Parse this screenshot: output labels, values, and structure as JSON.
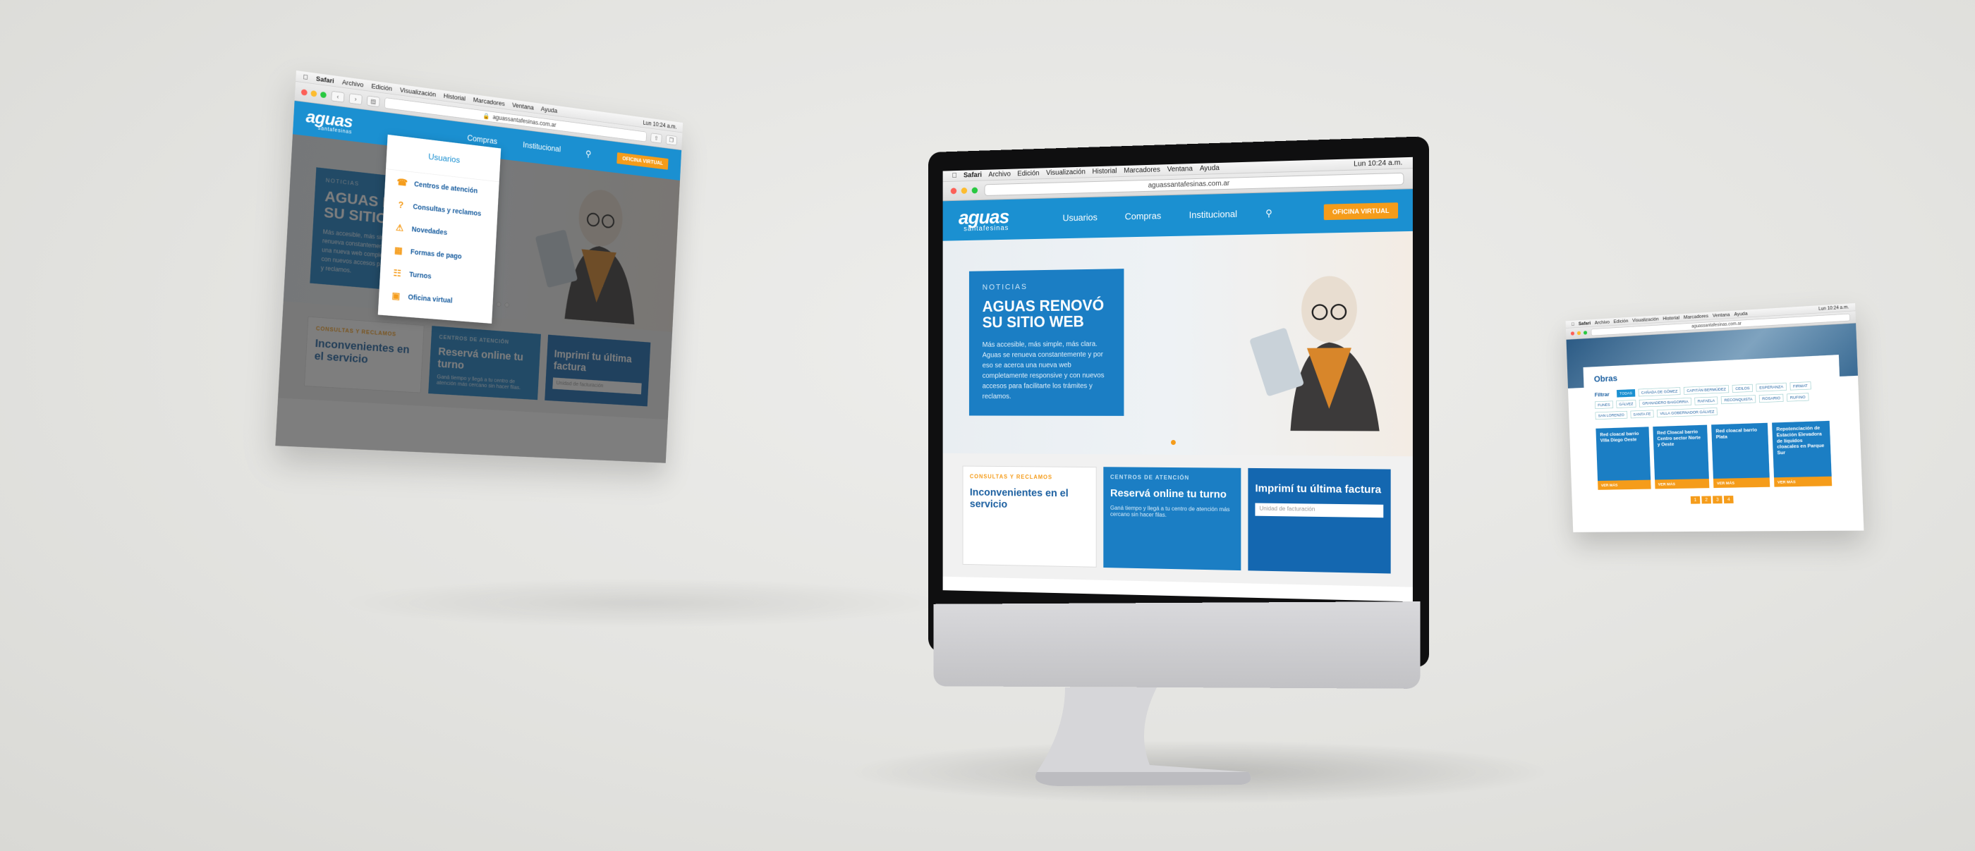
{
  "mac_menu": {
    "apple": "",
    "app": "Safari",
    "items": [
      "Archivo",
      "Edición",
      "Visualización",
      "Historial",
      "Marcadores",
      "Ventana",
      "Ayuda"
    ],
    "clock": "Lun 10:24 a.m."
  },
  "browser": {
    "url": "aguassantafesinas.com.ar"
  },
  "site": {
    "logo": "aguas",
    "logo_sub": "santafesinas",
    "nav": [
      "Usuarios",
      "Compras",
      "Institucional"
    ],
    "oficina_virtual": "OFICINA VIRTUAL",
    "hero_tag": "NOTICIAS",
    "hero_title": "AGUAS RENOVÓ SU SITIO WEB",
    "hero_text": "Más accesible, más simple, más clara. Aguas se renueva constantemente y por eso se acerca una nueva web completamente responsive y con nuevos accesos para facilitarte los trámites y reclamos.",
    "cards": [
      {
        "tag": "CONSULTAS Y RECLAMOS",
        "title": "Inconvenientes en el servicio"
      },
      {
        "tag": "CENTROS DE ATENCIÓN",
        "title": "Reservá online tu turno",
        "text": "Ganá tiempo y llegá a tu centro de atención más cercano sin hacer filas."
      },
      {
        "tag": "",
        "title": "Imprimí tu última factura",
        "placeholder": "Unidad de facturación"
      }
    ]
  },
  "dropdown": {
    "head": "Usuarios",
    "items": [
      {
        "label": "Centros de atención",
        "icon": "headset-icon"
      },
      {
        "label": "Consultas y reclamos",
        "icon": "question-icon"
      },
      {
        "label": "Novedades",
        "icon": "warning-icon"
      },
      {
        "label": "Formas de pago",
        "icon": "card-icon"
      },
      {
        "label": "Turnos",
        "icon": "calendar-icon"
      },
      {
        "label": "Oficina virtual",
        "icon": "window-icon"
      }
    ]
  },
  "obras": {
    "title": "Obras",
    "filter_label": "Filtrar",
    "chips": [
      "TODAS",
      "CAÑADA DE GÓMEZ",
      "CAPITÁN BERMÚDEZ",
      "CEILOS",
      "ESPERANZA",
      "FIRMAT",
      "FUNES",
      "GÁLVEZ",
      "GRANADERO BAIGORRIA",
      "RAFAELA",
      "RECONQUISTA",
      "ROSARIO",
      "RUFINO",
      "SAN LORENZO",
      "SANTA FE",
      "VILLA GOBERNADOR GÁLVEZ"
    ],
    "items": [
      {
        "title": "Red cloacal barrio Villa Diego Oeste",
        "more": "VER MÁS"
      },
      {
        "title": "Red Cloacal barrio Centro sector Norte y Oeste",
        "more": "VER MÁS"
      },
      {
        "title": "Red cloacal barrio Plata",
        "more": "VER MÁS"
      },
      {
        "title": "Repotenciación de Estación Elevadora de líquidos cloacales en Parque Sur",
        "more": "VER MÁS"
      }
    ],
    "pages": [
      "1",
      "2",
      "3",
      "4"
    ]
  }
}
